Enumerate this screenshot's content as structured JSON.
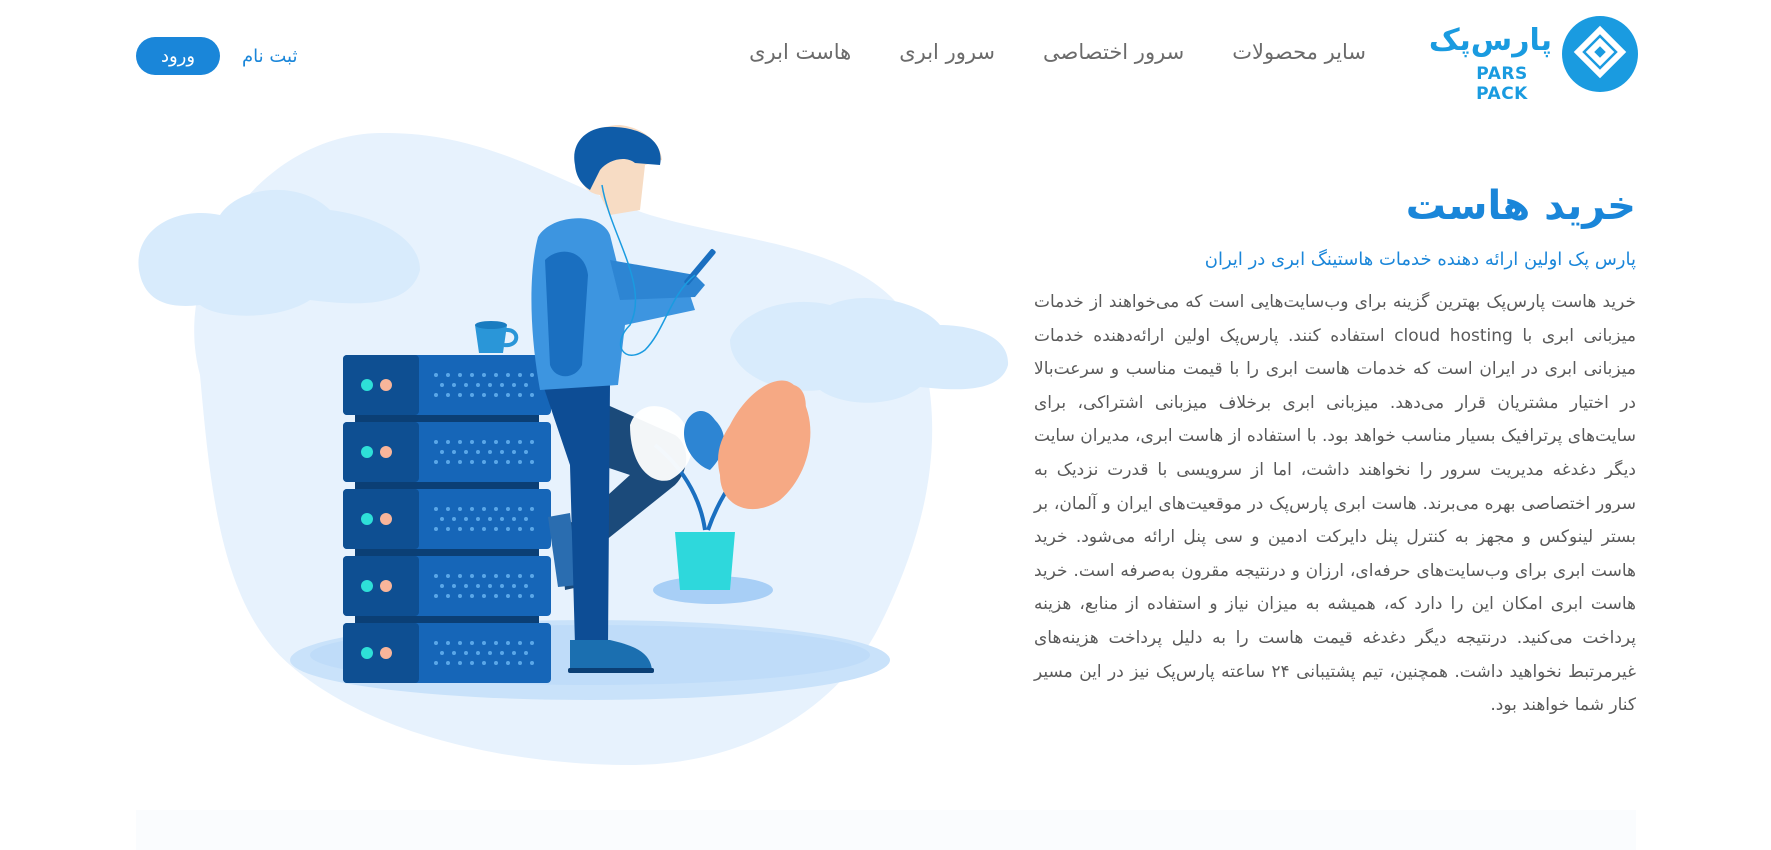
{
  "brand": {
    "name_fa": "پارس‌پک",
    "name_en": "PARS PACK",
    "color": "#1a9be0"
  },
  "nav": {
    "items": [
      {
        "label": "هاست ابری"
      },
      {
        "label": "سرور ابری"
      },
      {
        "label": "سرور اختصاصی"
      },
      {
        "label": "سایر محصولات"
      }
    ]
  },
  "auth": {
    "login_label": "ورود",
    "register_label": "ثبت نام"
  },
  "hero": {
    "title": "خرید هاست",
    "subtitle": "پارس پک اولین ارائه دهنده خدمات هاستینگ ابری در ایران",
    "body": "خرید هاست پارس‌پک بهترین گزینه برای وب‌سایت‌هایی است که می‌خواهند از خدمات میزبانی ابری با cloud hosting استفاده کنند. پارس‌پک اولین ارائه‌دهنده خدمات میزبانی ابری در ایران است که خدمات هاست ابری را با قیمت مناسب و سرعت‌بالا در اختیار مشتریان قرار می‌دهد. میزبانی ابری برخلاف میزبانی اشتراکی، برای سایت‌های پرترافیک بسیار مناسب خواهد بود. با استفاده از هاست ابری، مدیران سایت دیگر دغدغه مدیریت سرور را نخواهند داشت، اما از سرویسی با قدرت نزدیک به سرور اختصاصی بهره می‌برند. هاست ابری پارس‌پک در موقعیت‌های ایران و آلمان، بر بستر لینوکس و مجهز به کنترل پنل دایرکت ادمین و سی پنل ارائه می‌شود. خرید هاست ابری برای وب‌سایت‌های حرفه‌ای، ارزان و درنتیجه مقرون به‌صرفه است. خرید هاست ابری امکان این را دارد که، همیشه به میزان نیاز و استفاده از منابع، هزینه پرداخت می‌کنید. درنتیجه دیگر دغدغه قیمت هاست را به دلیل پرداخت هزینه‌های غیرمرتبط نخواهید داشت. همچنین، تیم پشتیبانی ۲۴ ساعته پارس‌پک نیز در این مسیر کنار شما خواهند بود."
  },
  "colors": {
    "accent": "#1a86d9",
    "text": "#5a5a5a",
    "nav_text": "#6b6b6b",
    "blob": "#e4f1fd"
  }
}
